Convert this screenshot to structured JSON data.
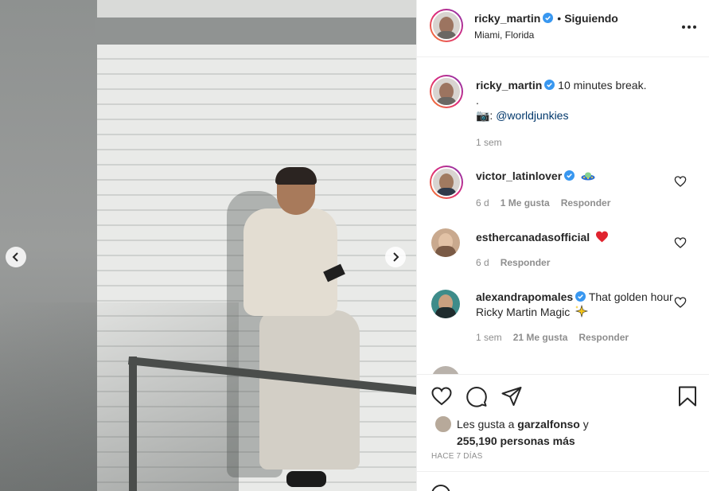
{
  "post": {
    "author": "ricky_martin",
    "follow_status": "Siguiendo",
    "separator": "•",
    "location": "Miami, Florida"
  },
  "caption": {
    "username": "ricky_martin",
    "text": "10 minutes break.",
    "line2": ".",
    "camera_emoji": "📷:",
    "mention": "@worldjunkies",
    "time": "1 sem"
  },
  "comments": [
    {
      "username": "victor_latinlover",
      "verified": true,
      "text": "",
      "emoji": "UFO",
      "time": "6 d",
      "likes": "1 Me gusta",
      "reply": "Responder"
    },
    {
      "username": "esthercanadasofficial",
      "verified": false,
      "text": "",
      "emoji": "red-heart",
      "time": "6 d",
      "likes": "",
      "reply": "Responder"
    },
    {
      "username": "alexandrapomales",
      "verified": true,
      "text": "That golden hour Ricky Martin Magic",
      "emoji": "sparkles",
      "time": "1 sem",
      "likes": "21 Me gusta",
      "reply": "Responder"
    }
  ],
  "likes": {
    "prefix": "Les gusta a",
    "user": "garzalfonso",
    "conj": "y",
    "count": "255,190 personas más"
  },
  "time_ago": "HACE 7 DÍAS",
  "colors": {
    "verified": "#3897f0",
    "heart": "#ed4956",
    "link": "#00376b",
    "muted": "#8e8e8e"
  },
  "icons": [
    "chevron-left-icon",
    "chevron-right-icon",
    "more-icon",
    "verified-icon",
    "heart-icon",
    "comment-icon",
    "share-icon",
    "bookmark-icon"
  ]
}
